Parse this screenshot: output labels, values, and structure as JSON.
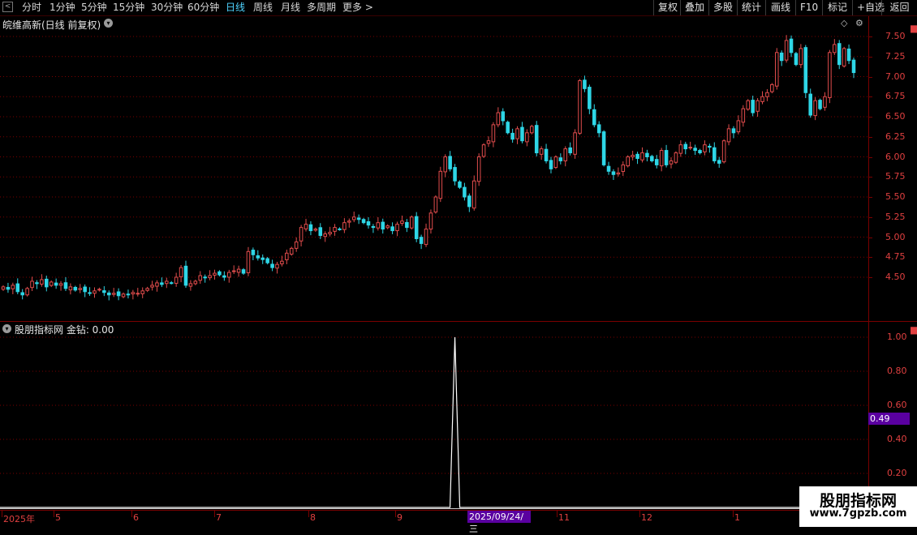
{
  "toolbar": {
    "back_label": "<",
    "period_tabs": [
      {
        "label": "分时",
        "active": false
      },
      {
        "label": "1分钟",
        "active": false
      },
      {
        "label": "5分钟",
        "active": false
      },
      {
        "label": "15分钟",
        "active": false
      },
      {
        "label": "30分钟",
        "active": false
      },
      {
        "label": "60分钟",
        "active": false
      },
      {
        "label": "日线",
        "active": true
      },
      {
        "label": "周线",
        "active": false
      },
      {
        "label": "月线",
        "active": false
      },
      {
        "label": "多周期",
        "active": false
      },
      {
        "label": "更多 >",
        "active": false
      }
    ],
    "right_buttons": [
      "复权",
      "叠加",
      "多股",
      "统计",
      "画线",
      "F10",
      "标记",
      "+自选",
      "返回"
    ]
  },
  "main_chart": {
    "title": "皖维高新(日线 前复权)",
    "price_ticks": [
      "7.50",
      "7.25",
      "7.00",
      "6.75",
      "6.50",
      "6.25",
      "6.00",
      "5.75",
      "5.50",
      "5.25",
      "5.00",
      "4.75",
      "4.50"
    ]
  },
  "indicator": {
    "title": "股朋指标网 金钻: 0.00",
    "ticks": [
      "1.00",
      "0.80",
      "0.60",
      "0.40",
      "0.20"
    ],
    "current_flag": "0.49"
  },
  "date_axis": {
    "labels": [
      "2025年",
      "5",
      "6",
      "7",
      "8",
      "9",
      "11",
      "12",
      "1"
    ],
    "cursor_date": "2025/09/24/三"
  },
  "watermark": {
    "line1": "股朋指标网",
    "line2": "www.7gpzb.com"
  },
  "colors": {
    "up": "#e04c4c",
    "down": "#2ed6e6",
    "grid": "#7a0000",
    "accent": "#4fd3ff",
    "flag": "#5a00a0"
  },
  "chart_data": {
    "type": "candlestick",
    "ylim": [
      4.2,
      7.6
    ],
    "indicator_ylim": [
      0,
      1.05
    ],
    "closes": [
      4.38,
      4.35,
      4.4,
      4.32,
      4.28,
      4.36,
      4.45,
      4.42,
      4.47,
      4.38,
      4.44,
      4.4,
      4.42,
      4.36,
      4.38,
      4.34,
      4.36,
      4.32,
      4.3,
      4.33,
      4.35,
      4.31,
      4.28,
      4.3,
      4.27,
      4.29,
      4.28,
      4.31,
      4.3,
      4.33,
      4.36,
      4.4,
      4.43,
      4.41,
      4.45,
      4.43,
      4.5,
      4.62,
      4.4,
      4.42,
      4.45,
      4.52,
      4.5,
      4.52,
      4.55,
      4.53,
      4.5,
      4.56,
      4.58,
      4.6,
      4.55,
      4.82,
      4.78,
      4.74,
      4.72,
      4.68,
      4.62,
      4.66,
      4.7,
      4.8,
      4.86,
      4.94,
      5.12,
      5.16,
      5.08,
      5.1,
      5.02,
      5.04,
      5.06,
      5.12,
      5.1,
      5.18,
      5.2,
      5.25,
      5.22,
      5.18,
      5.15,
      5.12,
      5.18,
      5.1,
      5.14,
      5.08,
      5.16,
      5.2,
      5.12,
      5.25,
      4.98,
      4.92,
      5.1,
      5.3,
      5.5,
      5.82,
      6.0,
      5.85,
      5.7,
      5.62,
      5.5,
      5.38,
      5.7,
      6.0,
      6.15,
      6.2,
      6.4,
      6.55,
      6.45,
      6.3,
      6.22,
      6.35,
      6.2,
      6.3,
      6.38,
      6.05,
      6.1,
      5.95,
      5.85,
      6.0,
      5.95,
      6.1,
      6.05,
      6.3,
      6.95,
      6.85,
      6.6,
      6.4,
      6.3,
      5.9,
      5.82,
      5.78,
      5.8,
      5.9,
      6.0,
      6.02,
      5.98,
      6.05,
      6.0,
      5.95,
      5.9,
      6.08,
      5.9,
      5.95,
      6.05,
      6.15,
      6.1,
      6.12,
      6.08,
      6.05,
      6.15,
      6.12,
      5.95,
      5.92,
      6.2,
      6.35,
      6.3,
      6.45,
      6.6,
      6.7,
      6.55,
      6.7,
      6.75,
      6.8,
      6.9,
      7.3,
      7.2,
      7.45,
      7.3,
      7.15,
      7.35,
      6.8,
      6.52,
      6.7,
      6.6,
      6.75,
      7.3,
      7.4,
      7.15,
      7.35,
      7.2,
      7.05
    ],
    "indicator_spike": {
      "index": 94,
      "value": 1.0
    }
  }
}
